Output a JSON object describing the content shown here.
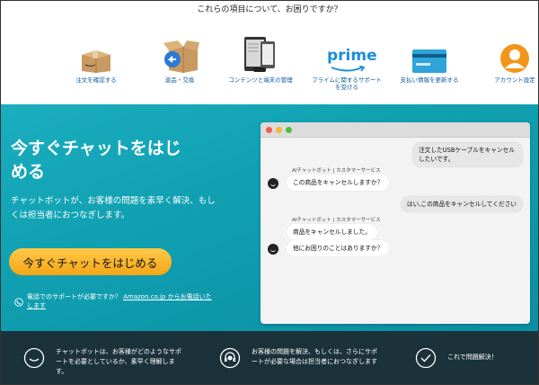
{
  "topics": {
    "title": "これらの項目について、お困りですか？",
    "items": [
      {
        "label": "注文を確認する",
        "icon": "package-box-icon"
      },
      {
        "label": "返品・交換",
        "icon": "return-box-icon"
      },
      {
        "label": "コンテンツと端末の管理",
        "icon": "devices-icon"
      },
      {
        "label": "プライムに関するサポートを受ける",
        "icon": "prime-logo-icon",
        "logo_text": "prime"
      },
      {
        "label": "支払い情報を更新する",
        "icon": "credit-card-icon"
      },
      {
        "label": "アカウント設定",
        "icon": "user-avatar-icon"
      }
    ]
  },
  "hero": {
    "title": "今すぐチャットをはじめる",
    "description": "チャットボットが、お客様の問題を素早く解決、もしくは担当者におつなぎします。",
    "cta_label": "今すぐチャットをはじめる",
    "phone_text": "電話でのサポートが必要ですか？",
    "phone_link": "Amazon.co.jp からお電話いたします"
  },
  "chat": {
    "messages": [
      {
        "from": "user",
        "text": "注文したUSBケーブルをキャンセルしたいです。"
      },
      {
        "from": "bot",
        "sender": "AIチャットボット | カスタマーサービス",
        "text": "この商品をキャンセルしますか？"
      },
      {
        "from": "user",
        "text": "はい,この商品をキャンセルしてください"
      },
      {
        "from": "bot",
        "sender": "AIチャットボット | カスタマーサービス",
        "text": "商品をキャンセルしました。"
      },
      {
        "from": "bot",
        "text": "他にお困りのことはありますか？"
      }
    ]
  },
  "features": [
    {
      "icon": "chatbot-face-icon",
      "text": "チャットボットは、お客様がどのようなサポートを必要としているか、素早く理解します。"
    },
    {
      "icon": "headset-agent-icon",
      "text": "お客様の問題を解決、もしくは、さらにサポートが必要な場合は担当者におつなぎします"
    },
    {
      "icon": "checkmark-circle-icon",
      "text": "これで問題解決！"
    }
  ],
  "colors": {
    "hero_bg": "#10a0b2",
    "cta": "#f5a514",
    "band_bg": "#1c323a",
    "link": "#0f5a9c"
  }
}
